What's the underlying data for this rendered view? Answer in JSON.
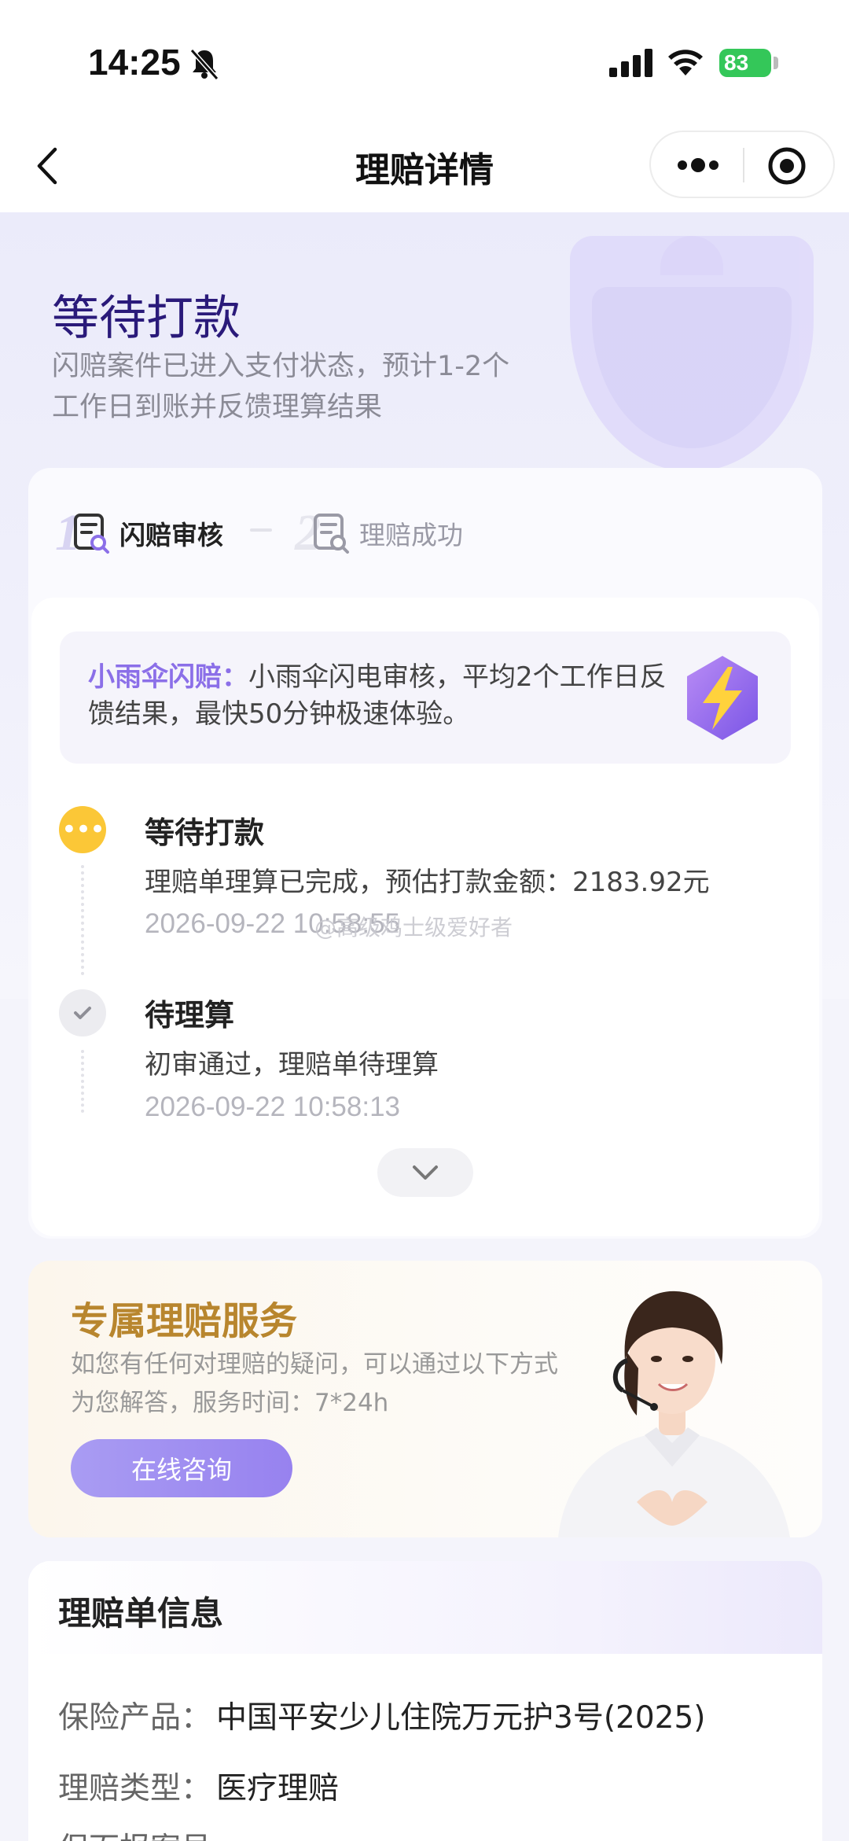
{
  "status_bar": {
    "time": "14:25",
    "battery": "83",
    "icons": [
      "bell-slash-icon",
      "signal-icon",
      "wifi-icon",
      "battery-icon"
    ]
  },
  "nav": {
    "title": "理赔详情",
    "back_icon": "chevron-left-icon",
    "more_icon": "more-dots-icon",
    "close_icon": "target-circle-icon"
  },
  "hero": {
    "title": "等待打款",
    "description": "闪赔案件已进入支付状态，预计1-2个工作日到账并反馈理算结果"
  },
  "steps": [
    {
      "num": "1",
      "label": "闪赔审核",
      "active": true
    },
    {
      "num": "2",
      "label": "理赔成功",
      "active": false
    }
  ],
  "flash": {
    "brand": "小雨伞闪赔：",
    "text": "小雨伞闪电审核，平均2个工作日反馈结果，最快50分钟极速体验。",
    "icon": "lightning-icon"
  },
  "timeline": [
    {
      "title": "等待打款",
      "desc": "理赔单理算已完成，预估打款金额：2183.92元",
      "time": "2026-09-22 10:58:55",
      "status": "active"
    },
    {
      "title": "待理算",
      "desc": "初审通过，理赔单待理算",
      "time": "2026-09-22 10:58:13",
      "status": "done"
    }
  ],
  "watermark": "@高级鸡士级爱好者",
  "service": {
    "title": "专属理赔服务",
    "description": "如您有任何对理赔的疑问，可以通过以下方式为您解答，服务时间：7*24h",
    "button": "在线咨询"
  },
  "info": {
    "title": "理赔单信息",
    "rows": [
      {
        "label": "保险产品：",
        "value": "中国平安少儿住院万元护3号(2025)"
      },
      {
        "label": "理赔类型：",
        "value": "医疗理赔"
      },
      {
        "label": "保面报案号",
        "value": ""
      }
    ]
  },
  "colors": {
    "accent": "#8b6fe8",
    "hero_title": "#2a1a7a",
    "active_dot": "#fbc737",
    "service_title": "#b8862e"
  }
}
